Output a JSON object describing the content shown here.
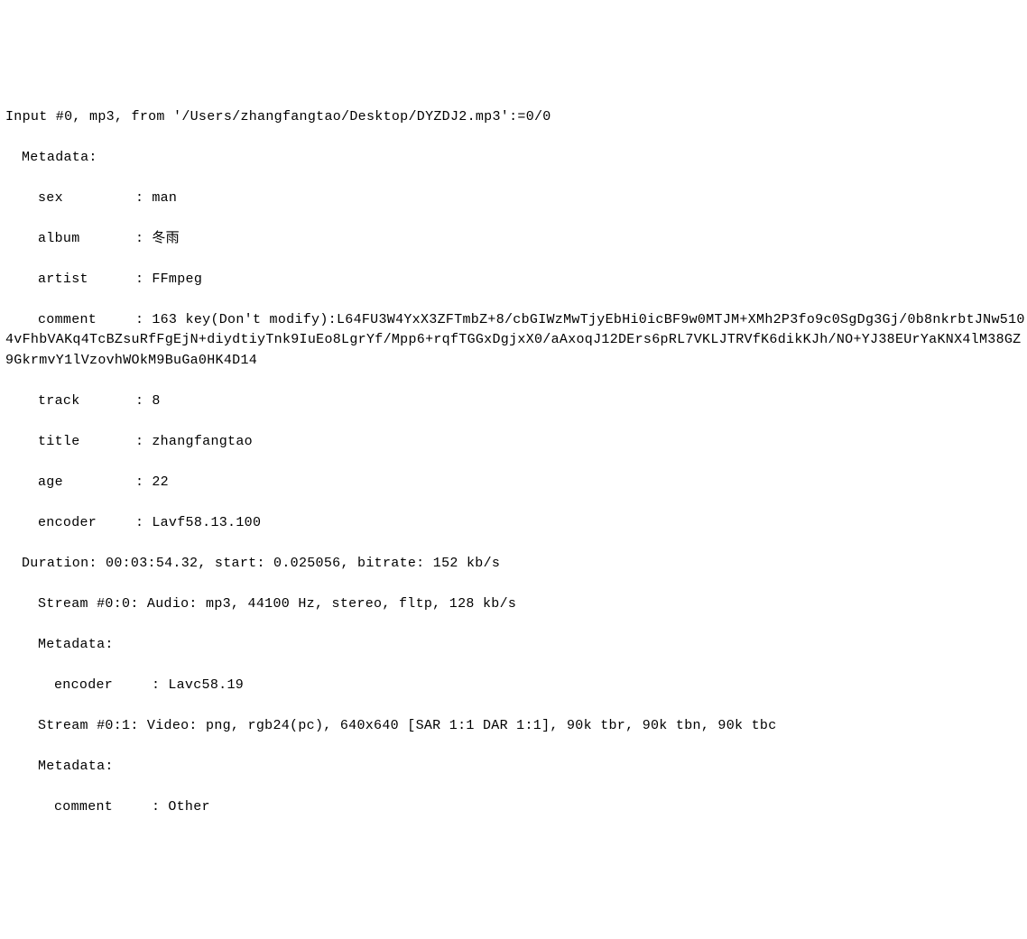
{
  "input_line": "Input #0, mp3, from '/Users/zhangfangtao/Desktop/DYZDJ2.mp3':=0/0",
  "metadata_header": "Metadata:",
  "metadata": {
    "sex": {
      "key": "sex",
      "value": "man"
    },
    "album": {
      "key": "album",
      "value": "冬雨"
    },
    "artist": {
      "key": "artist",
      "value": "FFmpeg"
    },
    "comment": {
      "key": "comment",
      "value": "163 key(Don't modify):L64FU3W4YxX3ZFTmbZ+8/cbGIWzMwTjyEbHi0icBF9w0MTJM+XMh2P3fo9c0SgDg3Gj/0b8nkrbtJNw5104vFhbVAKq4TcBZsuRfFgEjN+diydtiyTnk9IuEo8LgrYf/Mpp6+rqfTGGxDgjxX0/aAxoqJ12DErs6pRL7VKLJTRVfK6dikKJh/NO+YJ38EUrYaKNX4lM38GZ9GkrmvY1lVzovhWOkM9BuGa0HK4D14"
    },
    "track": {
      "key": "track",
      "value": "8"
    },
    "title": {
      "key": "title",
      "value": "zhangfangtao"
    },
    "age": {
      "key": "age",
      "value": "22"
    },
    "encoder": {
      "key": "encoder",
      "value": "Lavf58.13.100"
    }
  },
  "duration_line": "Duration: 00:03:54.32, start: 0.025056, bitrate: 152 kb/s",
  "stream0": "Stream #0:0: Audio: mp3, 44100 Hz, stereo, fltp, 128 kb/s",
  "stream0_metadata_header": "Metadata:",
  "stream0_encoder": {
    "key": "encoder",
    "value": "Lavc58.19"
  },
  "stream1": "Stream #0:1: Video: png, rgb24(pc), 640x640 [SAR 1:1 DAR 1:1], 90k tbr, 90k tbn, 90k tbc",
  "stream1_metadata_header": "Metadata:",
  "stream1_comment": {
    "key": "comment",
    "value": "Other"
  }
}
